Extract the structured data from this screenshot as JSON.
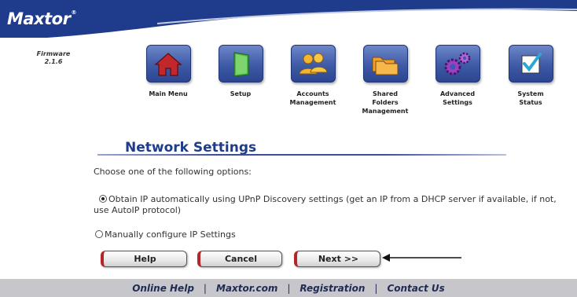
{
  "brand": {
    "logo": "Maxtor",
    "trademark": "®"
  },
  "firmware": {
    "label": "Firmware",
    "version": "2.1.6"
  },
  "nav": [
    {
      "label_lines": [
        "Main Menu"
      ],
      "icon": "house-icon"
    },
    {
      "label_lines": [
        "Setup"
      ],
      "icon": "door-icon"
    },
    {
      "label_lines": [
        "Accounts",
        "Management"
      ],
      "icon": "users-icon"
    },
    {
      "label_lines": [
        "Shared",
        "Folders",
        "Management"
      ],
      "icon": "folders-icon"
    },
    {
      "label_lines": [
        "Advanced",
        "Settings"
      ],
      "icon": "gears-icon"
    },
    {
      "label_lines": [
        "System",
        "Status"
      ],
      "icon": "checkmark-icon"
    }
  ],
  "page": {
    "title": "Network Settings",
    "prompt": "Choose one of the following options:",
    "options": [
      {
        "label": "Obtain IP automatically using UPnP Discovery settings (get an IP from a DHCP server if available, if not, use AutoIP protocol)",
        "selected": true
      },
      {
        "label": "Manually configure IP Settings",
        "selected": false
      }
    ]
  },
  "buttons": {
    "help": "Help",
    "cancel": "Cancel",
    "next": "Next >>"
  },
  "footer": {
    "links": [
      "Online Help",
      "Maxtor.com",
      "Registration",
      "Contact Us"
    ],
    "separator": "|"
  },
  "colors": {
    "header_blue": "#1f3c8c",
    "accent_red": "#b3262a",
    "footer_gray": "#c7c7cb"
  }
}
